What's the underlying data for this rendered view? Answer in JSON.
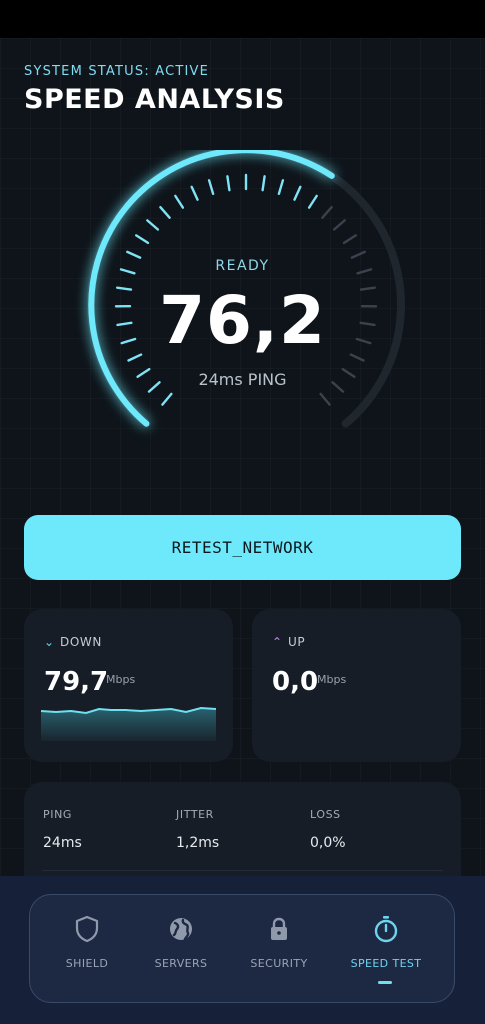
{
  "header": {
    "status": "SYSTEM STATUS: ACTIVE",
    "title": "SPEED ANALYSIS"
  },
  "gauge": {
    "state": "READY",
    "speed": "76,2",
    "ping": "24ms PING",
    "fill_fraction": 0.62,
    "accent_color": "#6ee9fb"
  },
  "retest_button": {
    "label": "RETEST_NETWORK"
  },
  "download": {
    "label": "DOWN",
    "value": "79,7",
    "unit": "Mbps"
  },
  "upload": {
    "label": "UP",
    "value": "0,0",
    "unit": "Mbps"
  },
  "stats": {
    "ping": {
      "label": "PING",
      "value": "24ms"
    },
    "jitter": {
      "label": "JITTER",
      "value": "1,2ms"
    },
    "loss": {
      "label": "LOSS",
      "value": "0,0%"
    }
  },
  "nav": {
    "items": [
      {
        "label": "SHIELD",
        "icon": "shield-icon"
      },
      {
        "label": "SERVERS",
        "icon": "globe-icon"
      },
      {
        "label": "SECURITY",
        "icon": "lock-icon"
      },
      {
        "label": "SPEED TEST",
        "icon": "stopwatch-icon",
        "active": true
      }
    ]
  }
}
